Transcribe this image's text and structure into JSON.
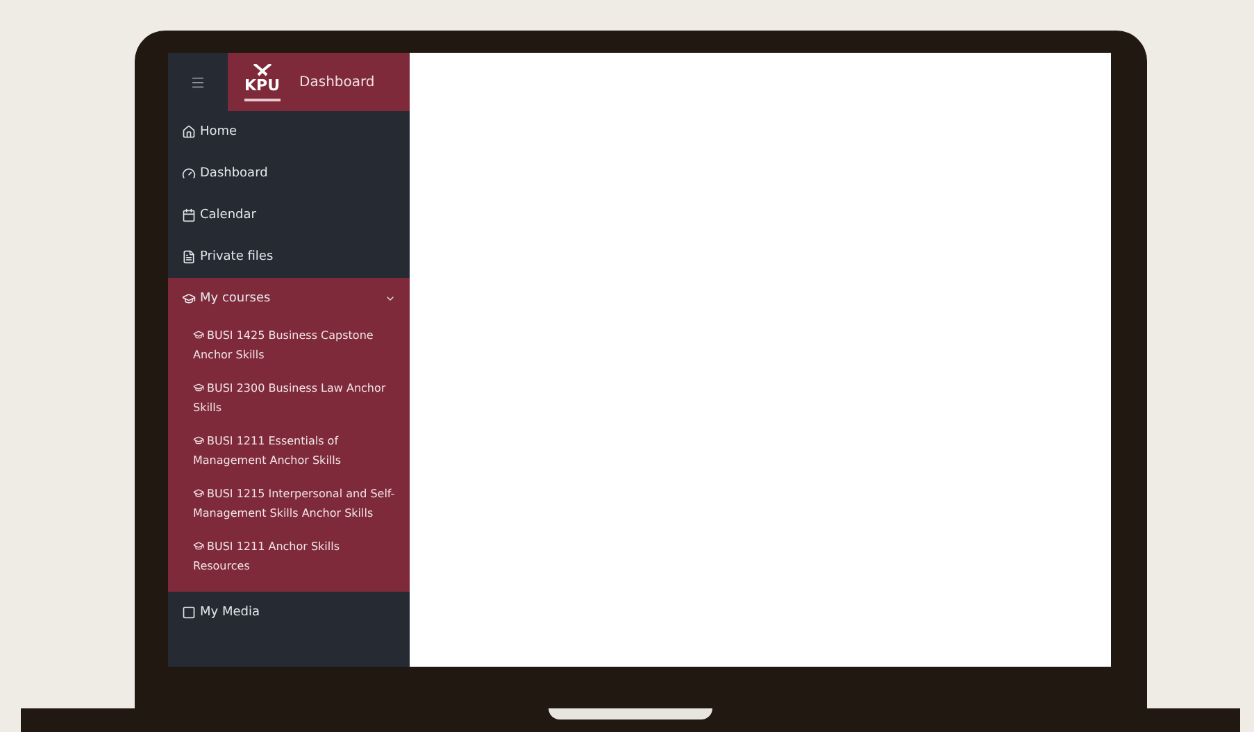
{
  "header": {
    "logo": "KPU",
    "title": "Dashboard"
  },
  "nav": [
    {
      "label": "Home",
      "selected": false
    },
    {
      "label": "Dashboard",
      "selected": false
    },
    {
      "label": "Calendar",
      "selected": false
    },
    {
      "label": "Private files",
      "selected": false
    },
    {
      "label": "My courses",
      "selected": true,
      "expanded": true,
      "children": [
        {
          "label": "BUSI 1425 Business Capstone Anchor Skills"
        },
        {
          "label": "BUSI 2300 Business Law Anchor Skills"
        },
        {
          "label": "BUSI 1211 Essentials of Management Anchor Skills"
        },
        {
          "label": "BUSI 1215 Interpersonal and Self-Management Skills Anchor Skills"
        },
        {
          "label": "BUSI 1211 Anchor Skills Resources"
        }
      ]
    },
    {
      "label": "My Media",
      "selected": false
    }
  ]
}
